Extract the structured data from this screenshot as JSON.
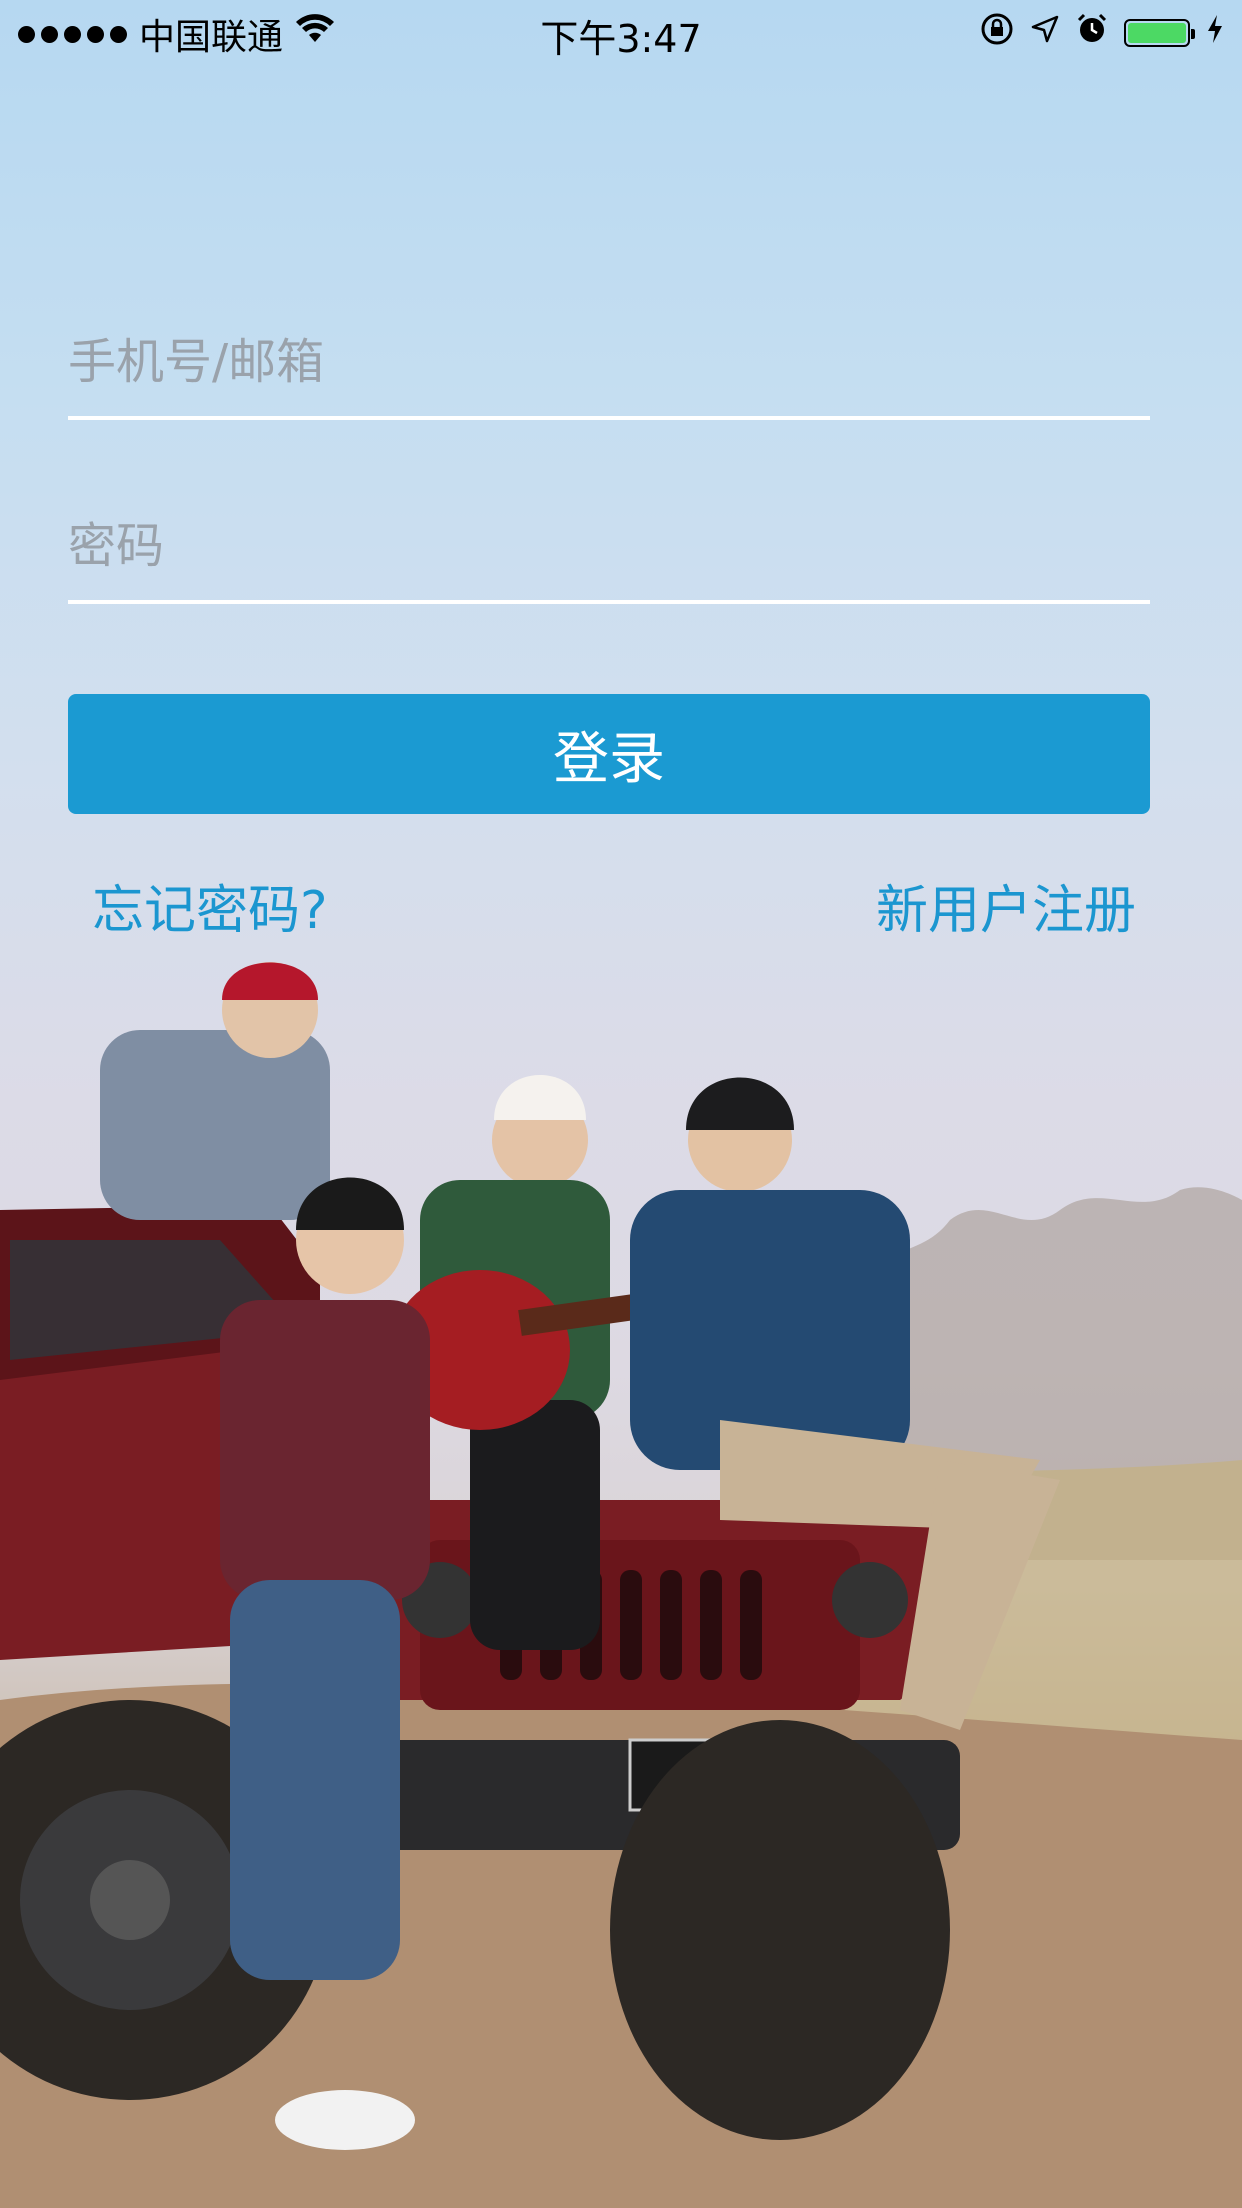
{
  "status_bar": {
    "carrier": "中国联通",
    "time": "下午3:47",
    "battery_color": "#4cd964"
  },
  "login_form": {
    "account_placeholder": "手机号/邮箱",
    "password_placeholder": "密码",
    "login_label": "登录",
    "forgot_label": "忘记密码?",
    "register_label": "新用户注册"
  },
  "colors": {
    "accent": "#1b9ad2",
    "link": "#1b96d0",
    "underline": "#ffffff"
  },
  "icons": [
    "wifi-icon",
    "orientation-lock-icon",
    "location-icon",
    "alarm-icon",
    "battery-icon",
    "charging-icon"
  ],
  "background_image": "photo of four young people on a red jeep with a guitar in a dusty field"
}
